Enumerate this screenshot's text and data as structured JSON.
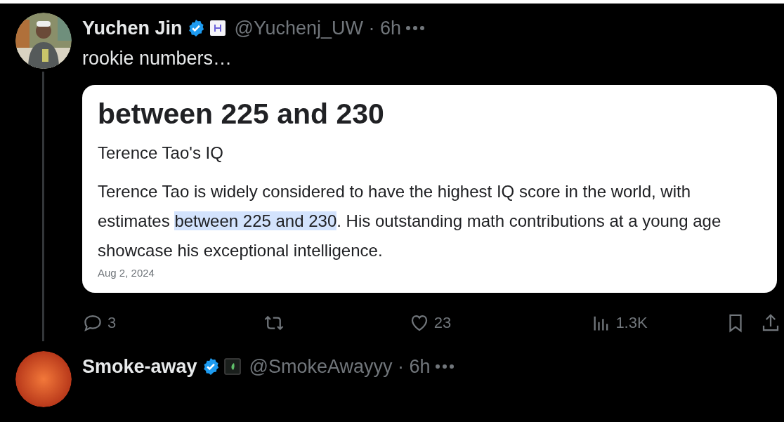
{
  "tweets": [
    {
      "author": "Yuchen Jin",
      "verified": true,
      "handle": "@Yuchenj_UW · 6h",
      "text": "rookie numbers…",
      "card": {
        "heading": "between 225 and 230",
        "subtitle": "Terence Tao's IQ",
        "paragraph": [
          {
            "text": "Terence Tao is widely considered to have the highest IQ score in the world, with estimates ",
            "highlighted": false
          },
          {
            "text": "between 225 and 230",
            "highlighted": true
          },
          {
            "text": ". His outstanding math contributions at a young age showcase his exceptional intelligence.",
            "highlighted": false
          }
        ],
        "date": "Aug 2, 2024"
      },
      "actions": [
        {
          "kind": "reply",
          "count": "3"
        },
        {
          "kind": "repost"
        },
        {
          "kind": "like",
          "count": "23"
        },
        {
          "kind": "views",
          "count": "1.3K"
        },
        {
          "kind": "bookmark"
        },
        {
          "kind": "share"
        }
      ]
    },
    {
      "author": "Smoke-away",
      "verified": true,
      "handle": "@SmokeAwayyy · 6h",
      "avatar": {
        "kind": "orange"
      }
    }
  ]
}
